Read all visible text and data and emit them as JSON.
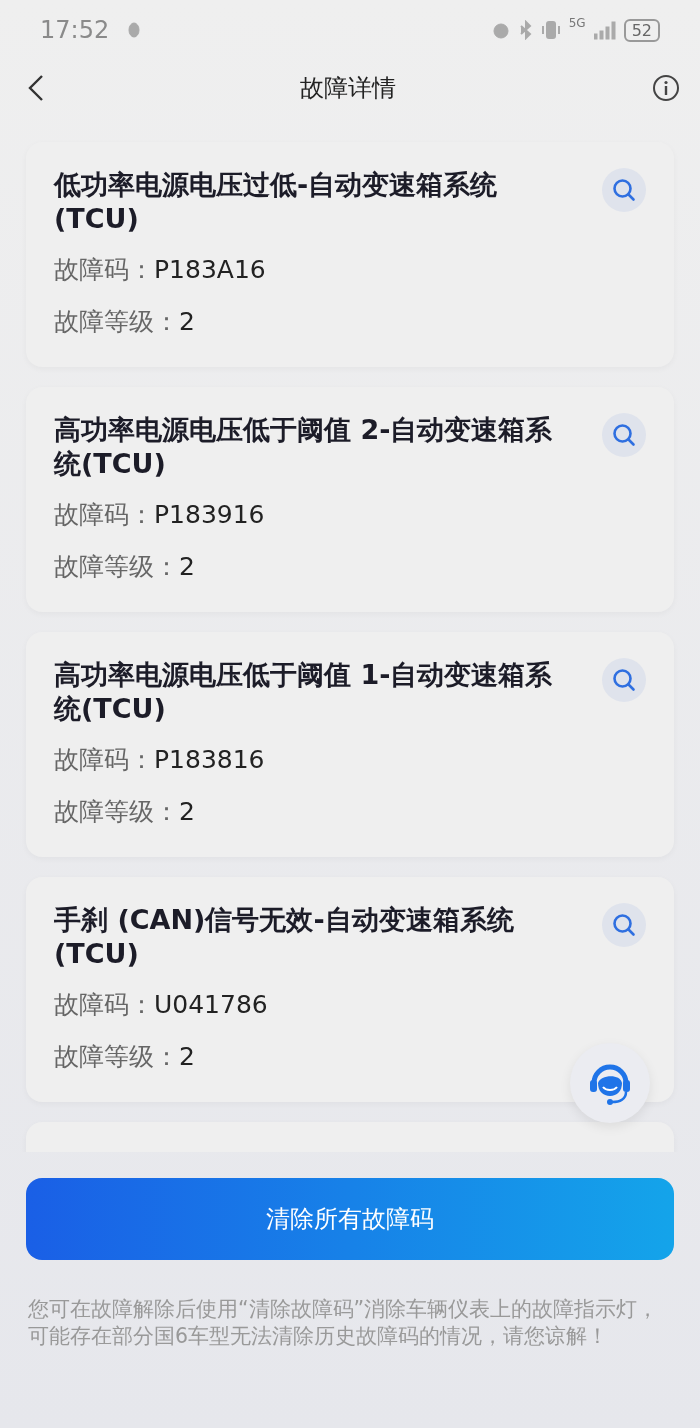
{
  "status_bar": {
    "time": "17:52",
    "network": "5G",
    "battery": "52"
  },
  "header": {
    "title": "故障详情"
  },
  "faults": [
    {
      "title": "低功率电源电压过低-自动变速箱系统(TCU)",
      "code_label": "故障码：",
      "code": "P183A16",
      "level_label": "故障等级：",
      "level": "2"
    },
    {
      "title": "高功率电源电压低于阈值 2-自动变速箱系统(TCU)",
      "code_label": "故障码：",
      "code": "P183916",
      "level_label": "故障等级：",
      "level": "2"
    },
    {
      "title": "高功率电源电压低于阈值 1-自动变速箱系统(TCU)",
      "code_label": "故障码：",
      "code": "P183816",
      "level_label": "故障等级：",
      "level": "2"
    },
    {
      "title": "手刹 (CAN)信号无效-自动变速箱系统(TCU)",
      "code_label": "故障码：",
      "code": "U041786",
      "level_label": "故障等级：",
      "level": "2"
    }
  ],
  "clear_button": {
    "label": "清除所有故障码"
  },
  "notice": "您可在故障解除后使用“清除故障码”消除车辆仪表上的故障指示灯，可能存在部分国6车型无法清除历史故障码的情况，请您谅解！"
}
